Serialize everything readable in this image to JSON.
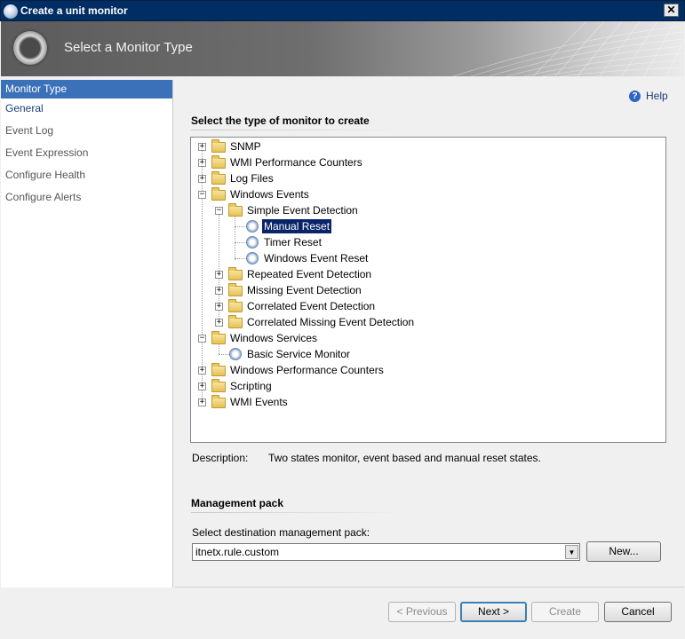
{
  "window": {
    "title": "Create a unit monitor",
    "close_glyph": "✕"
  },
  "banner": {
    "heading": "Select a Monitor Type"
  },
  "nav": {
    "items": [
      {
        "label": "Monitor Type"
      },
      {
        "label": "General"
      },
      {
        "label": "Event Log"
      },
      {
        "label": "Event Expression"
      },
      {
        "label": "Configure Health"
      },
      {
        "label": "Configure Alerts"
      }
    ]
  },
  "help": {
    "label": "Help",
    "icon": "?"
  },
  "tree_section": {
    "title": "Select the type of monitor to create"
  },
  "tree": {
    "nodes": [
      {
        "label": "SNMP"
      },
      {
        "label": "WMI Performance Counters"
      },
      {
        "label": "Log Files"
      },
      {
        "label": "Windows Events"
      },
      {
        "label": "Simple Event Detection"
      },
      {
        "label": "Manual Reset"
      },
      {
        "label": "Timer Reset"
      },
      {
        "label": "Windows Event Reset"
      },
      {
        "label": "Repeated Event Detection"
      },
      {
        "label": "Missing Event Detection"
      },
      {
        "label": "Correlated Event Detection"
      },
      {
        "label": "Correlated Missing Event Detection"
      },
      {
        "label": "Windows Services"
      },
      {
        "label": "Basic Service Monitor"
      },
      {
        "label": "Windows Performance Counters"
      },
      {
        "label": "Scripting"
      },
      {
        "label": "WMI Events"
      }
    ],
    "expander_plus": "+",
    "expander_minus": "−"
  },
  "description": {
    "label": "Description:",
    "text": "Two states monitor, event based and manual reset states."
  },
  "management_pack": {
    "title": "Management pack",
    "label": "Select destination management pack:",
    "value": "itnetx.rule.custom",
    "arrow": "▼",
    "new_button": "New..."
  },
  "buttons": {
    "previous": "< Previous",
    "next": "Next >",
    "create": "Create",
    "cancel": "Cancel"
  }
}
